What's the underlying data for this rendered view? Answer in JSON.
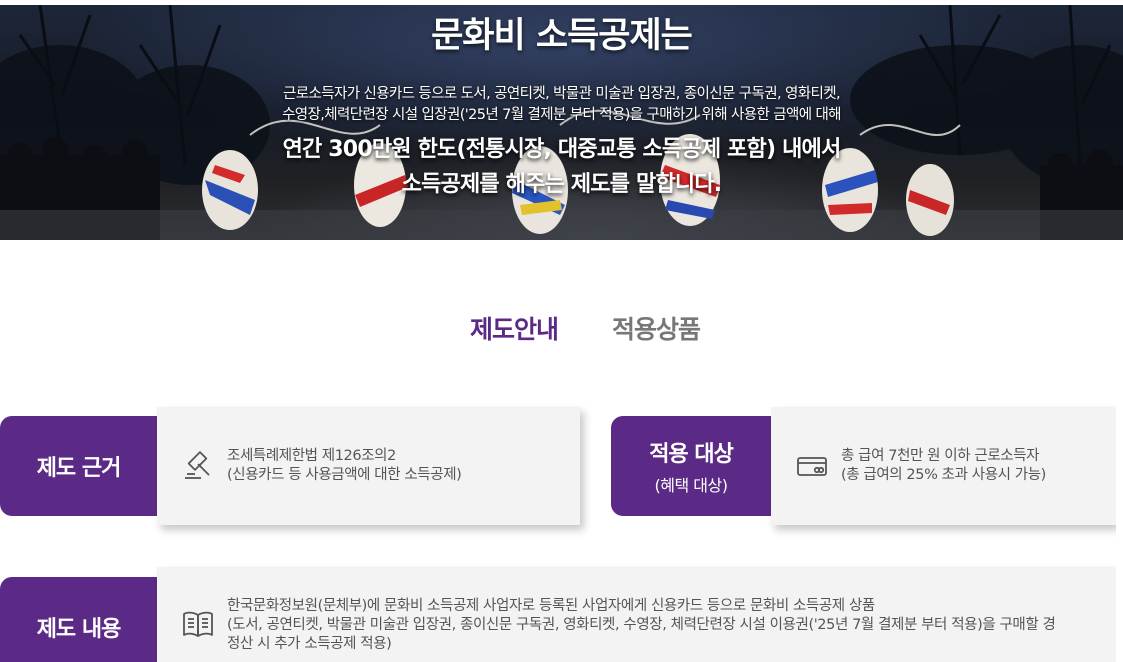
{
  "hero": {
    "title": "문화비 소득공제는",
    "desc_line1": "근로소득자가 신용카드 등으로 도서, 공연티켓, 박물관 미술관 입장권, 종이신문 구독권, 영화티켓,",
    "desc_line2": "수영장,체력단련장 시설 입장권('25년 7월 결제분 부터 적용)을 구매하기 위해 사용한 금액에 대해",
    "strong_line1": "연간 300만원 한도(전통시장, 대중교통 소득공제 포함) 내에서",
    "strong_line2": "소득공제를 해주는 제도를 말합니다."
  },
  "tabs": [
    {
      "label": "제도안내",
      "active": true
    },
    {
      "label": "적용상품",
      "active": false
    }
  ],
  "rows": {
    "basis": {
      "label": "제도 근거",
      "icon": "gavel-icon",
      "line1": "조세특례제한법 제126조의2",
      "line2": "(신용카드 등 사용금액에 대한 소득공제)"
    },
    "target": {
      "label": "적용 대상",
      "sublabel": "(혜택 대상)",
      "icon": "credit-card-icon",
      "line1": "총 급여 7천만 원 이하 근로소득자",
      "line2": "(총 급여의 25% 초과 사용시 가능)"
    },
    "content": {
      "label": "제도 내용",
      "icon": "book-icon",
      "line1": "한국문화정보원(문체부)에 문화비 소득공제 사업자로 등록된 사업자에게 신용카드 등으로 문화비 소득공제 상품",
      "line2": "(도서, 공연티켓, 박물관 미술관 입장권, 종이신문 구독권, 영화티켓, 수영장, 체력단련장 시설 이용권('25년 7월 결제분 부터 적용)을 구매할 경",
      "line3": "정산 시 추가 소득공제 적용)"
    }
  },
  "colors": {
    "brand_purple": "#5b2a86",
    "tab_highlight": "#fbe99a",
    "content_bg": "#f3f3f3"
  }
}
